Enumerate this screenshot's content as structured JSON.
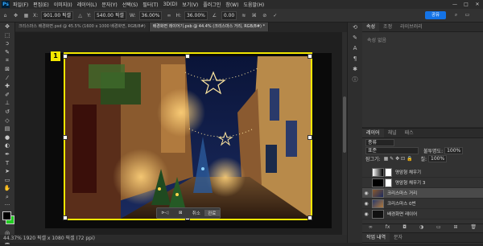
{
  "menubar": {
    "logo": "Ps",
    "items": [
      "파일(F)",
      "편집(E)",
      "이미지(I)",
      "레이어(L)",
      "문자(Y)",
      "선택(S)",
      "필터(T)",
      "3D(D)",
      "보기(V)",
      "플러그인",
      "창(W)",
      "도움말(H)"
    ],
    "window_controls": [
      "—",
      "□",
      "✕"
    ]
  },
  "optionsbar": {
    "x_label": "X:",
    "x_value": "901.00 픽셀",
    "y_label": "Y:",
    "y_value": "540.00 픽셀",
    "w_label": "W:",
    "w_value": "36.00%",
    "h_label": "H:",
    "h_value": "36.00%",
    "angle_value": "0.00",
    "share_label": "공유"
  },
  "tabs": [
    {
      "label": "크리스마스 배경화면.psd @ 45.5% (1600 x 1000 배경화면, RGB/8#)"
    },
    {
      "label": "배경화면 레이어기.psb @ 44.4% (크리스마스 거리, RGB/8#) *"
    }
  ],
  "canvas": {
    "artboard_number": "1",
    "transform_bar": {
      "flip": "⊳◁",
      "warp": "⊠",
      "cancel": "취소",
      "done": "완료"
    }
  },
  "status": {
    "text": "44.37%   1920 픽셀 x 1080 픽셀 (72 ppi)"
  },
  "props_panel": {
    "tabs": [
      "속성",
      "조정",
      "라이브러리"
    ],
    "subtitle": "속성 없음"
  },
  "layers_panel": {
    "tabs": [
      "레이어",
      "채널",
      "패스"
    ],
    "filter_label": "종류",
    "blend_mode": "표준",
    "opacity_label": "불투명도:",
    "opacity_value": "100%",
    "lock_label": "잠그기:",
    "fill_label": "칠:",
    "fill_value": "100%",
    "layers": [
      {
        "name": "명암형 채우기",
        "selected": false
      },
      {
        "name": "명암형 채우기 3",
        "selected": false
      },
      {
        "name": "크리스마스 거리",
        "selected": true
      },
      {
        "name": "크리스마스 0번",
        "selected": false
      },
      {
        "name": "배경화면 레이어",
        "selected": false
      }
    ],
    "bottom_icons": [
      "link-icon",
      "fx-icon",
      "mask-icon",
      "adjust-icon",
      "folder-icon",
      "new-icon",
      "trash-icon"
    ]
  },
  "history_panel": {
    "tabs": [
      "작업 내역",
      "문자"
    ]
  },
  "colors": {
    "artboard_border": "#f2e600",
    "accent": "#1473e6",
    "foreground": "#000000",
    "background_swatch": "#22cc22"
  }
}
